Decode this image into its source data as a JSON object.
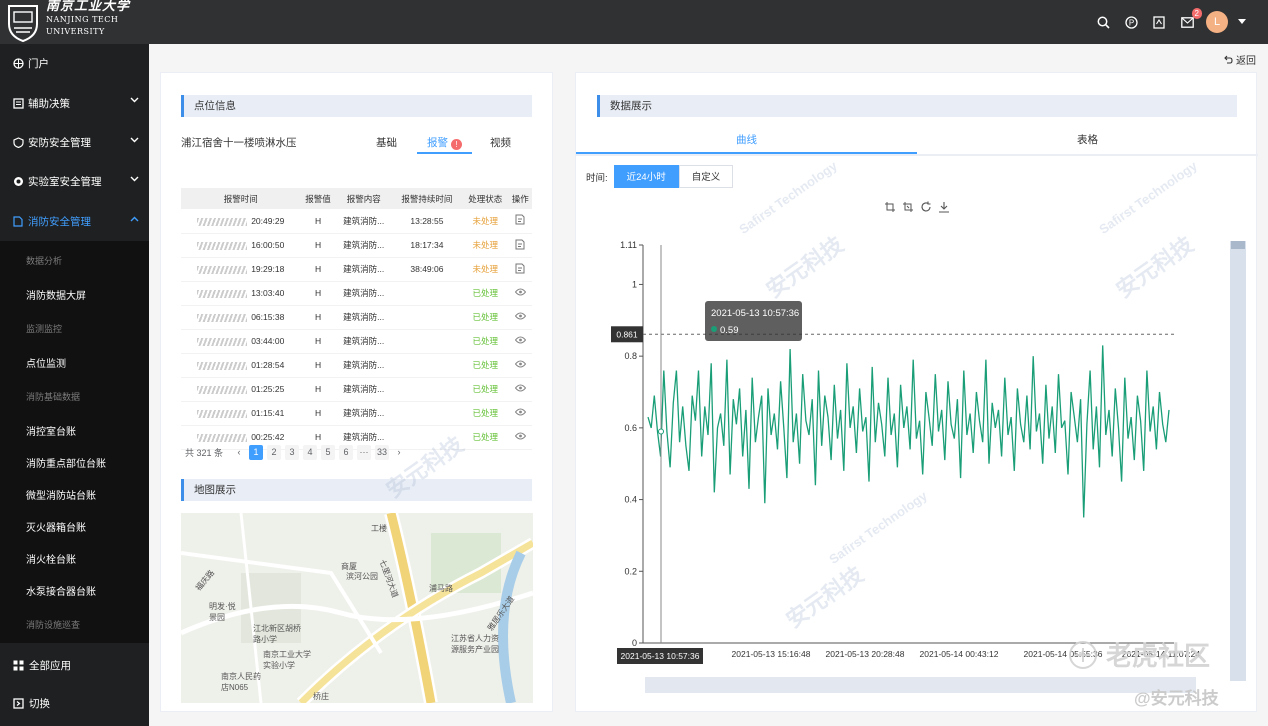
{
  "brand": {
    "cn": "南京工业大学",
    "en1": "NANJING TECH",
    "en2": "UNIVERSITY"
  },
  "header": {
    "mail_badge": "2",
    "avatar": "L"
  },
  "sidebar": {
    "items": [
      {
        "label": "门户"
      },
      {
        "label": "辅助决策"
      },
      {
        "label": "安防安全管理"
      },
      {
        "label": "实验室安全管理"
      },
      {
        "label": "消防安全管理"
      }
    ],
    "sub": [
      {
        "type": "head",
        "label": "数据分析"
      },
      {
        "type": "item",
        "label": "消防数据大屏"
      },
      {
        "type": "head",
        "label": "监测监控"
      },
      {
        "type": "item",
        "label": "点位监测"
      },
      {
        "type": "head",
        "label": "消防基础数据"
      },
      {
        "type": "item",
        "label": "消控室台账"
      },
      {
        "type": "item",
        "label": "消防重点部位台账"
      },
      {
        "type": "item",
        "label": "微型消防站台账"
      },
      {
        "type": "item",
        "label": "灭火器箱台账"
      },
      {
        "type": "item",
        "label": "消火栓台账"
      },
      {
        "type": "item",
        "label": "水泵接合器台账"
      },
      {
        "type": "head",
        "label": "消防设施巡查"
      }
    ],
    "all_apps": "全部应用",
    "switch": "切换"
  },
  "main": {
    "back": "返回"
  },
  "point_info": {
    "title": "点位信息",
    "location": "浦江宿舍十一楼喷淋水压",
    "tabs": [
      "基础",
      "报警",
      "视频"
    ],
    "alert_mark": "!",
    "columns": [
      "报警时间",
      "报警值",
      "报警内容",
      "报警持续时间",
      "处理状态",
      "操作"
    ],
    "rows": [
      {
        "time": "20:49:29",
        "value": "H",
        "content": "建筑消防...",
        "duration": "13:28:55",
        "status": "未处理",
        "op": "edit"
      },
      {
        "time": "16:00:50",
        "value": "H",
        "content": "建筑消防...",
        "duration": "18:17:34",
        "status": "未处理",
        "op": "edit"
      },
      {
        "time": "19:29:18",
        "value": "H",
        "content": "建筑消防...",
        "duration": "38:49:06",
        "status": "未处理",
        "op": "edit"
      },
      {
        "time": "13:03:40",
        "value": "H",
        "content": "建筑消防...",
        "duration": "",
        "status": "已处理",
        "op": "view"
      },
      {
        "time": "06:15:38",
        "value": "H",
        "content": "建筑消防...",
        "duration": "",
        "status": "已处理",
        "op": "view"
      },
      {
        "time": "03:44:00",
        "value": "H",
        "content": "建筑消防...",
        "duration": "",
        "status": "已处理",
        "op": "view"
      },
      {
        "time": "01:28:54",
        "value": "H",
        "content": "建筑消防...",
        "duration": "",
        "status": "已处理",
        "op": "view"
      },
      {
        "time": "01:25:25",
        "value": "H",
        "content": "建筑消防...",
        "duration": "",
        "status": "已处理",
        "op": "view"
      },
      {
        "time": "01:15:41",
        "value": "H",
        "content": "建筑消防...",
        "duration": "",
        "status": "已处理",
        "op": "view"
      },
      {
        "time": "00:25:42",
        "value": "H",
        "content": "建筑消防...",
        "duration": "",
        "status": "已处理",
        "op": "view"
      }
    ],
    "pager": {
      "total": "共 321 条",
      "pages": [
        "1",
        "2",
        "3",
        "4",
        "5",
        "6",
        "···",
        "33"
      ],
      "current": "1"
    }
  },
  "map_section": {
    "title": "地图展示",
    "labels": [
      "工楼",
      "七里河大道",
      "浦马路",
      "明发·悦景园",
      "江北新区胡桥路小学",
      "南京工业大学实验小学",
      "南京人民药店N065",
      "江苏省人力资源服务产业园",
      "福庆路",
      "雅居乐大道",
      "桥庄",
      "商厦",
      "滨河公园"
    ]
  },
  "data_panel": {
    "title": "数据展示",
    "tabs": [
      "曲线",
      "表格"
    ],
    "time_label": "时间:",
    "time_buttons": [
      "近24小时",
      "自定义"
    ],
    "tooltip": {
      "time": "2021-05-13 10:57:36",
      "value": "0.59"
    },
    "axis_pointer_y": "0.861",
    "axis_pointer_x": "2021-05-13 10:57:36"
  },
  "watermark": {
    "text": "安元科技",
    "en": "Safirst Technology",
    "forum": "老虎社区",
    "credit": "@安元科技"
  },
  "chart_data": {
    "type": "line",
    "yticks": [
      "0",
      "0.2",
      "0.4",
      "0.6",
      "0.8",
      "1",
      "1.11"
    ],
    "ylim": [
      0,
      1.11
    ],
    "xticks": [
      "2021-05-13 10:04:24",
      "2021-05-13 15:16:48",
      "2021-05-13 20:28:48",
      "2021-05-14 00:43:12",
      "2021-05-14 05:55:36",
      "2021-05-14 11:07:24"
    ],
    "color": "#1a9e77",
    "series": [
      {
        "values": [
          0.63,
          0.6,
          0.69,
          0.59,
          0.52,
          0.76,
          0.59,
          0.49,
          0.67,
          0.76,
          0.56,
          0.66,
          0.55,
          0.48,
          0.69,
          0.62,
          0.76,
          0.52,
          0.66,
          0.58,
          0.78,
          0.42,
          0.6,
          0.64,
          0.55,
          0.79,
          0.47,
          0.68,
          0.61,
          0.71,
          0.52,
          0.65,
          0.43,
          0.74,
          0.56,
          0.63,
          0.69,
          0.39,
          0.71,
          0.58,
          0.64,
          0.54,
          0.73,
          0.6,
          0.46,
          0.82,
          0.56,
          0.64,
          0.5,
          0.75,
          0.62,
          0.58,
          0.68,
          0.44,
          0.76,
          0.55,
          0.69,
          0.63,
          0.51,
          0.72,
          0.57,
          0.65,
          0.48,
          0.78,
          0.6,
          0.66,
          0.53,
          0.71,
          0.59,
          0.63,
          0.45,
          0.77,
          0.56,
          0.67,
          0.61,
          0.52,
          0.74,
          0.58,
          0.64,
          0.49,
          0.72,
          0.6,
          0.66,
          0.54,
          0.79,
          0.57,
          0.62,
          0.47,
          0.7,
          0.63,
          0.55,
          0.75,
          0.59,
          0.65,
          0.51,
          0.73,
          0.61,
          0.57,
          0.68,
          0.46,
          0.76,
          0.58,
          0.64,
          0.53,
          0.7,
          0.62,
          0.56,
          0.79,
          0.5,
          0.67,
          0.6,
          0.65,
          0.52,
          0.74,
          0.58,
          0.63,
          0.48,
          0.71,
          0.61,
          0.56,
          0.69,
          0.54,
          0.8,
          0.59,
          0.64,
          0.5,
          0.72,
          0.57,
          0.66,
          0.53,
          0.75,
          0.6,
          0.62,
          0.47,
          0.7,
          0.63,
          0.56,
          0.68,
          0.35,
          0.61,
          0.76,
          0.54,
          0.66,
          0.49,
          0.83,
          0.58,
          0.65,
          0.52,
          0.71,
          0.6,
          0.45,
          0.74,
          0.57,
          0.63,
          0.51,
          0.69,
          0.62,
          0.48,
          0.76,
          0.59,
          0.66,
          0.54,
          0.7,
          0.61,
          0.56,
          0.65
        ]
      }
    ]
  }
}
